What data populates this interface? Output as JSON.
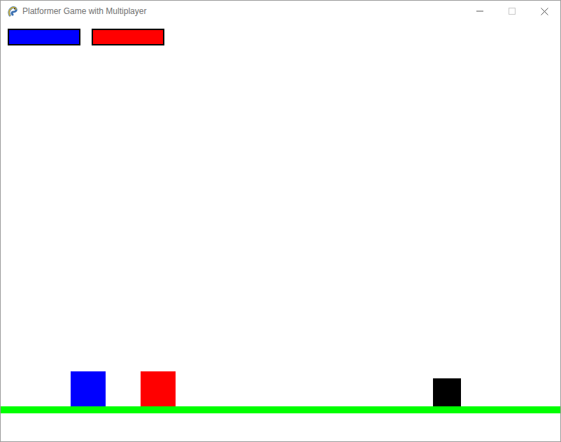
{
  "window": {
    "title": "Platformer Game with Multiplayer"
  },
  "health_bars": [
    {
      "level": 1,
      "color": "#0000ff"
    },
    {
      "level": 1,
      "color": "#ff0000"
    }
  ],
  "players": [
    {
      "color": "#0000ff"
    },
    {
      "color": "#ff0000"
    }
  ],
  "enemies": [
    {
      "color": "#000000"
    }
  ]
}
